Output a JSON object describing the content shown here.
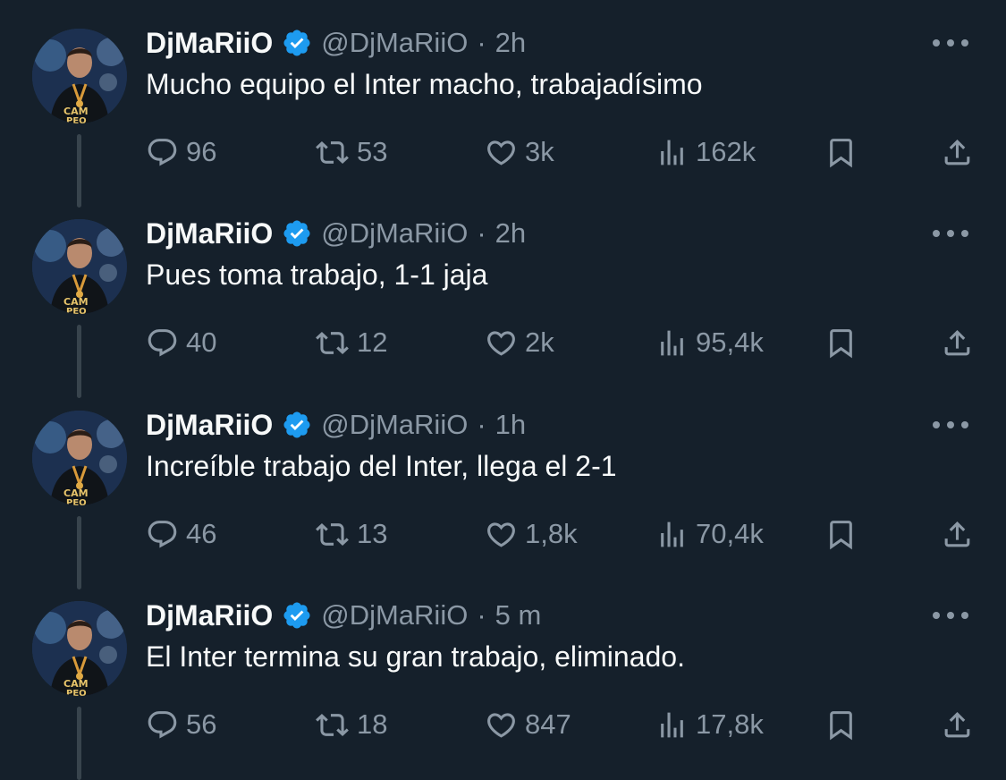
{
  "colors": {
    "background": "#15202b",
    "text_primary": "#f7f9f9",
    "text_secondary": "#8b98a5",
    "verified_badge": "#1d9bf0",
    "thread_line": "#38444d"
  },
  "icons": {
    "more": "more-dots-icon",
    "reply": "reply-bubble-icon",
    "retweet": "retweet-arrows-icon",
    "like": "heart-icon",
    "views": "views-bars-icon",
    "bookmark": "bookmark-icon",
    "share": "share-upload-icon",
    "verified": "verified-check-icon"
  },
  "tweets": [
    {
      "name": "DjMaRiiO",
      "handle": "@DjMaRiiO",
      "separator": "·",
      "time": "2h",
      "text": "Mucho equipo el Inter macho, trabajadísimo",
      "replies": "96",
      "retweets": "53",
      "likes": "3k",
      "views": "162k"
    },
    {
      "name": "DjMaRiiO",
      "handle": "@DjMaRiiO",
      "separator": "·",
      "time": "2h",
      "text": "Pues toma trabajo, 1-1 jaja",
      "replies": "40",
      "retweets": "12",
      "likes": "2k",
      "views": "95,4k"
    },
    {
      "name": "DjMaRiiO",
      "handle": "@DjMaRiiO",
      "separator": "·",
      "time": "1h",
      "text": "Increíble trabajo del Inter, llega el 2-1",
      "replies": "46",
      "retweets": "13",
      "likes": "1,8k",
      "views": "70,4k"
    },
    {
      "name": "DjMaRiiO",
      "handle": "@DjMaRiiO",
      "separator": "·",
      "time": "5 m",
      "text": "El Inter termina su gran trabajo, eliminado.",
      "replies": "56",
      "retweets": "18",
      "likes": "847",
      "views": "17,8k"
    }
  ]
}
